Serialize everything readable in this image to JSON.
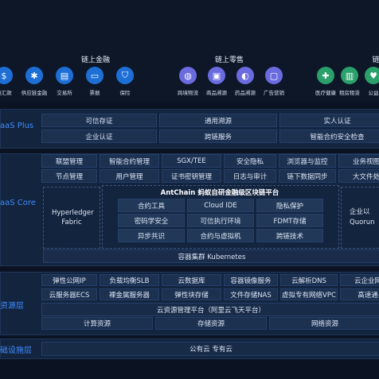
{
  "top": {
    "finance": {
      "title": "链上金融",
      "items": [
        {
          "label": "境汇款",
          "icon": "remittance-icon",
          "color": "#1d6fd6"
        },
        {
          "label": "供应链金融",
          "icon": "network-icon",
          "color": "#1d6fd6"
        },
        {
          "label": "交易所",
          "icon": "chart-icon",
          "color": "#1d6fd6"
        },
        {
          "label": "票据",
          "icon": "bill-icon",
          "color": "#1d6fd6"
        },
        {
          "label": "保险",
          "icon": "shield-icon",
          "color": "#1d6fd6"
        }
      ]
    },
    "retail": {
      "title": "链上零售",
      "items": [
        {
          "label": "跨境物流",
          "icon": "globe-icon",
          "color": "#6b6be0"
        },
        {
          "label": "商品溯源",
          "icon": "box-icon",
          "color": "#6b6be0"
        },
        {
          "label": "药品溯源",
          "icon": "pill-icon",
          "color": "#6b6be0"
        },
        {
          "label": "广告营销",
          "icon": "ad-icon",
          "color": "#6b6be0"
        }
      ]
    },
    "third": {
      "title": "链",
      "items": [
        {
          "label": "医疗健康",
          "icon": "medical-icon",
          "color": "#2aa06a"
        },
        {
          "label": "租房租赁",
          "icon": "building-icon",
          "color": "#2aa06a"
        },
        {
          "label": "公益",
          "icon": "charity-icon",
          "color": "#2aa06a"
        }
      ]
    }
  },
  "baas_plus": {
    "label": "aaS Plus",
    "row1": [
      "可信存证",
      "通用溯源",
      "实人认证"
    ],
    "row2": [
      "企业认证",
      "跨链服务",
      "智能合约安全检查"
    ]
  },
  "baas_core": {
    "label": "aaS Core",
    "row1": [
      "联盟管理",
      "智能合约管理",
      "SGX/TEE",
      "安全隐私",
      "浏览器与监控",
      "业务视图"
    ],
    "row2": [
      "节点管理",
      "用户管理",
      "证书密钥管理",
      "日志与审计",
      "链下数据同步",
      "大文件处"
    ],
    "left_box": "Hyperledger Fabric",
    "antchain_title": "AntChain 蚂蚁自研金融级区块链平台",
    "antchain_grid": [
      [
        "合约工具",
        "Cloud IDE",
        "隐私保护"
      ],
      [
        "密码学安全",
        "可信执行环境",
        "FDMT存储"
      ],
      [
        "异步共识",
        "合约与虚拟机",
        "跨链技术"
      ]
    ],
    "right_box": "企业以\nQuorun",
    "k8s": "容器集群 Kubernetes"
  },
  "resource": {
    "label": "资源层",
    "row1": [
      "弹性公网IP",
      "负载均衡SLB",
      "云数据库",
      "容器镜像服务",
      "云解析DNS",
      "云企业网"
    ],
    "row2": [
      "云服务器ECS",
      "裸金属服务器",
      "弹性块存储",
      "文件存储NAS",
      "虚拟专有网络VPC",
      "高速通"
    ],
    "mgmt": "云资源管理平台（阿里云飞天平台）",
    "row4": [
      "计算资源",
      "存储资源",
      "网络资源"
    ]
  },
  "infra": {
    "label": "础设施层",
    "value": "公有云 专有云"
  },
  "colors": {
    "accent": "#3f8cff",
    "background": "#0b1322",
    "cell": "#1c3050"
  }
}
